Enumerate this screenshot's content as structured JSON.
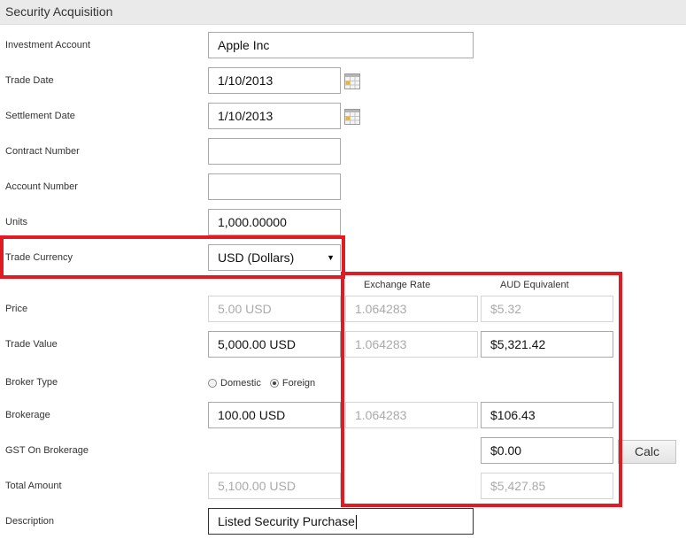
{
  "header": {
    "title": "Security Acquisition"
  },
  "columns": {
    "exchange_rate": "Exchange Rate",
    "aud_equivalent": "AUD Equivalent"
  },
  "labels": {
    "investment_account": "Investment Account",
    "trade_date": "Trade Date",
    "settlement_date": "Settlement Date",
    "contract_number": "Contract Number",
    "account_number": "Account Number",
    "units": "Units",
    "trade_currency": "Trade Currency",
    "price": "Price",
    "trade_value": "Trade Value",
    "broker_type": "Broker Type",
    "brokerage": "Brokerage",
    "gst_on_brokerage": "GST On Brokerage",
    "total_amount": "Total Amount",
    "description": "Description"
  },
  "values": {
    "investment_account": "Apple Inc",
    "trade_date": "1/10/2013",
    "settlement_date": "1/10/2013",
    "contract_number": "",
    "account_number": "",
    "units": "1,000.00000",
    "trade_currency": "USD (Dollars)",
    "price": "5.00 USD",
    "price_rate": "1.064283",
    "price_aud": "$5.32",
    "trade_value": "5,000.00 USD",
    "trade_value_rate": "1.064283",
    "trade_value_aud": "$5,321.42",
    "brokerage": "100.00 USD",
    "brokerage_rate": "1.064283",
    "brokerage_aud": "$106.43",
    "gst_aud": "$0.00",
    "total_amount": "5,100.00 USD",
    "total_aud": "$5,427.85",
    "description": "Listed Security Purchase"
  },
  "broker_type": {
    "domestic": "Domestic",
    "foreign": "Foreign",
    "selected": "Foreign"
  },
  "buttons": {
    "calc": "Calc"
  },
  "icons": {
    "calendar": "calendar-icon",
    "dropdown": "dropdown-arrow-icon"
  },
  "colors": {
    "highlight": "#e01b24",
    "header_bg": "#eaeaea"
  }
}
